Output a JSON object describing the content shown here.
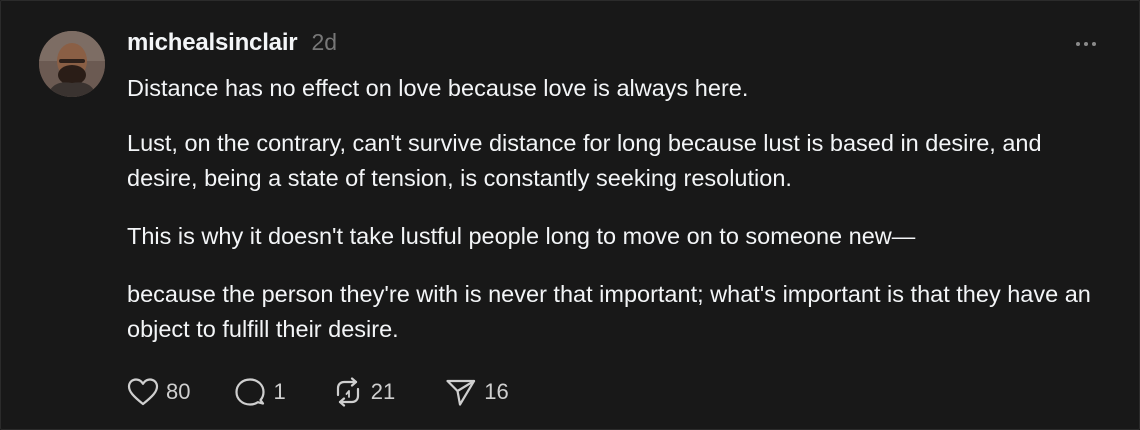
{
  "post": {
    "username": "michealsinclair",
    "timestamp": "2d",
    "paragraphs": [
      "Distance has no effect on love because love is always here.",
      "Lust, on the contrary, can't survive distance for long because lust is based in desire, and desire, being a state of tension, is constantly seeking resolution.",
      "This is why it doesn't take lustful people long to move on to someone new—",
      "because the person they're with is never that important; what's important is that they have an object to fulfill their desire."
    ],
    "actions": {
      "likes": "80",
      "replies": "1",
      "reposts": "21",
      "shares": "16"
    }
  },
  "icons": {
    "like": "heart-icon",
    "reply": "comment-icon",
    "repost": "repost-icon",
    "share": "send-icon",
    "more": "more-horizontal-icon"
  },
  "colors": {
    "background": "#181818",
    "text": "#f3f5f7",
    "muted": "#777777",
    "icon": "#cfcfcf"
  }
}
